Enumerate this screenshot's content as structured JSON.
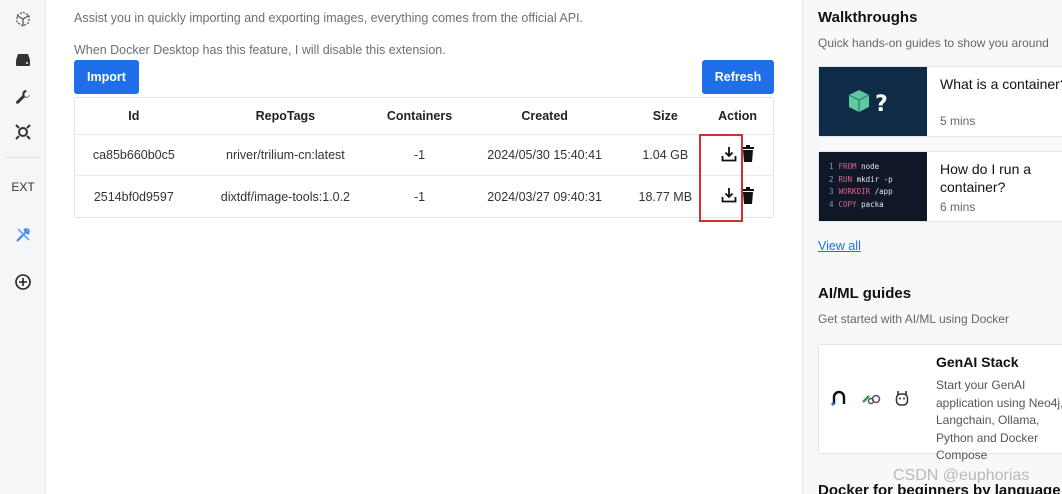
{
  "rail": {
    "ext_label": "EXT"
  },
  "main": {
    "description_1": "Assist you in quickly importing and exporting images, everything comes from the official API.",
    "description_2": "When Docker Desktop has this feature, I will disable this extension.",
    "import_label": "Import",
    "refresh_label": "Refresh",
    "table": {
      "headers": [
        "Id",
        "RepoTags",
        "Containers",
        "Created",
        "Size",
        "Action"
      ],
      "rows": [
        [
          "ca85b660b0c5",
          "nriver/trilium-cn:latest",
          "-1",
          "2024/05/30 15:40:41",
          "1.04 GB"
        ],
        [
          "2514bf0d9597",
          "dixtdf/image-tools:1.0.2",
          "-1",
          "2024/03/27 09:40:31",
          "18.77 MB"
        ]
      ]
    }
  },
  "side": {
    "walkthroughs_title": "Walkthroughs",
    "walkthroughs_sub": "Quick hands-on guides to show you around",
    "card1": {
      "title": "What is a container?",
      "meta": "5 mins"
    },
    "card2": {
      "title_line1": "How do I run a",
      "title_line2": "container?",
      "meta": "6 mins",
      "code": [
        {
          "num": "1",
          "kw": "FROM",
          "rest": "node"
        },
        {
          "num": "2",
          "kw": "RUN",
          "rest": "mkdir -p"
        },
        {
          "num": "3",
          "kw": "WORKDIR",
          "rest": "/app"
        },
        {
          "num": "4",
          "kw": "COPY",
          "rest": "packa"
        }
      ]
    },
    "view_all": "View all",
    "aiml_title": "AI/ML guides",
    "aiml_sub": "Get started with AI/ML using Docker",
    "genai": {
      "title": "GenAI Stack",
      "desc": "Start your GenAI application using Neo4j, Langchain, Ollama, Python and Docker Compose"
    },
    "beginners_title": "Docker for beginners by language"
  },
  "watermark": "CSDN @euphorias",
  "colors": {
    "accent": "#1f6feb",
    "highlight": "#d0312d",
    "thumb": "#0f2b48"
  }
}
